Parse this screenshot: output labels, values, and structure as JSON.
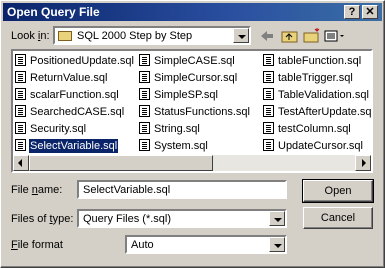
{
  "window": {
    "title": "Open Query File",
    "help_label": "?",
    "close_label": "✕"
  },
  "lookin": {
    "label_pre": "Look ",
    "label_key": "i",
    "label_post": "n:",
    "value": "SQL 2000 Step by Step"
  },
  "files": [
    "PositionedUpdate.sql",
    "ReturnValue.sql",
    "scalarFunction.sql",
    "SearchedCASE.sql",
    "Security.sql",
    "SelectVariable.sql",
    "SimpleCASE.sql",
    "SimpleCursor.sql",
    "SimpleSP.sql",
    "StatusFunctions.sql",
    "String.sql",
    "System.sql",
    "tableFunction.sql",
    "tableTrigger.sql",
    "TableValidation.sql",
    "TestAfterUpdate.sql",
    "testColumn.sql",
    "UpdateCursor.sql"
  ],
  "selected_file": "SelectVariable.sql",
  "filename": {
    "label_pre": "File ",
    "label_key": "n",
    "label_post": "ame:",
    "value": "SelectVariable.sql"
  },
  "filetype": {
    "label_pre": "Files of ",
    "label_key": "t",
    "label_post": "ype:",
    "value": "Query Files (*.sql)"
  },
  "fileformat": {
    "label_key": "F",
    "label_post": "ile format",
    "value": "Auto"
  },
  "buttons": {
    "open": "Open",
    "cancel": "Cancel"
  },
  "icons": [
    "folder-icon",
    "back-arrow-icon",
    "up-folder-icon",
    "new-folder-icon",
    "view-menu-icon",
    "sql-file-icon"
  ]
}
